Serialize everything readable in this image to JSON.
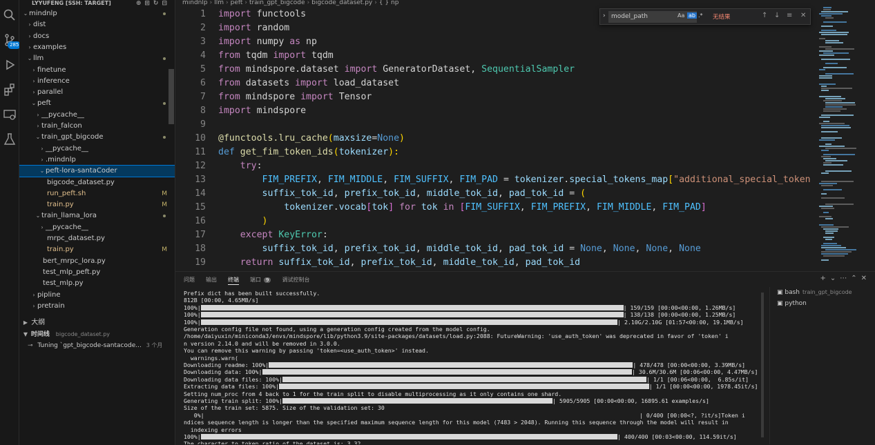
{
  "activity_bar": {
    "icons": [
      "search-icon",
      "source-control-icon",
      "run-debug-icon",
      "extensions-icon",
      "remote-explorer-icon",
      "testing-icon"
    ],
    "source_control_badge": "285"
  },
  "sidebar": {
    "header": "LYYUFENG [SSH: TARGET]",
    "tree": [
      {
        "label": "mindnlp",
        "depth": 1,
        "chev": "open",
        "dot": true
      },
      {
        "label": "dist",
        "depth": 2,
        "chev": "closed"
      },
      {
        "label": "docs",
        "depth": 2,
        "chev": "closed"
      },
      {
        "label": "examples",
        "depth": 2,
        "chev": "closed"
      },
      {
        "label": "llm",
        "depth": 2,
        "chev": "open",
        "dot": true
      },
      {
        "label": "finetune",
        "depth": 3,
        "chev": "closed"
      },
      {
        "label": "inference",
        "depth": 3,
        "chev": "closed"
      },
      {
        "label": "parallel",
        "depth": 3,
        "chev": "closed"
      },
      {
        "label": "peft",
        "depth": 3,
        "chev": "open",
        "dot": true
      },
      {
        "label": "__pycache__",
        "depth": 4,
        "chev": "closed"
      },
      {
        "label": "train_falcon",
        "depth": 4,
        "chev": "closed"
      },
      {
        "label": "train_gpt_bigcode",
        "depth": 4,
        "chev": "open",
        "dot": true
      },
      {
        "label": "__pycache__",
        "depth": 5,
        "chev": "closed"
      },
      {
        "label": ".mindnlp",
        "depth": 5,
        "chev": "closed"
      },
      {
        "label": "peft-lora-santaCoder",
        "depth": 5,
        "chev": "open",
        "selected": true
      },
      {
        "label": "bigcode_dataset.py",
        "depth": 5,
        "chev": "none",
        "active": true
      },
      {
        "label": "run_peft.sh",
        "depth": 5,
        "chev": "none",
        "git": "M",
        "modified": true
      },
      {
        "label": "train.py",
        "depth": 5,
        "chev": "none",
        "git": "M",
        "modified": true
      },
      {
        "label": "train_llama_lora",
        "depth": 4,
        "chev": "open",
        "dot": true
      },
      {
        "label": "__pycache__",
        "depth": 5,
        "chev": "closed"
      },
      {
        "label": "mrpc_dataset.py",
        "depth": 5,
        "chev": "none"
      },
      {
        "label": "train.py",
        "depth": 5,
        "chev": "none",
        "git": "M",
        "modified": true
      },
      {
        "label": "bert_mrpc_lora.py",
        "depth": 4,
        "chev": "none"
      },
      {
        "label": "test_mlp_peft.py",
        "depth": 4,
        "chev": "none"
      },
      {
        "label": "test_mlp.py",
        "depth": 4,
        "chev": "none"
      },
      {
        "label": "pipline",
        "depth": 3,
        "chev": "closed"
      },
      {
        "label": "pretrain",
        "depth": 3,
        "chev": "closed"
      }
    ],
    "outline_label": "大纲",
    "timeline_label": "时间线",
    "timeline_file": "bigcode_dataset.py",
    "timeline_entry": "Tuning `gpt_bigcode-santacode...",
    "timeline_time": "3 个月"
  },
  "editor": {
    "breadcrumb": [
      "mindnlp",
      "llm",
      "peft",
      "train_gpt_bigcode",
      "bigcode_dataset.py",
      "{ } np"
    ],
    "find": {
      "value": "model_path",
      "opt_case": "Aa",
      "opt_word": "ab",
      "opt_regex": ".*",
      "result": "无结果"
    },
    "lines": [
      {
        "n": "1"
      },
      {
        "n": "2"
      },
      {
        "n": "3"
      },
      {
        "n": "4"
      },
      {
        "n": "5"
      },
      {
        "n": "6"
      },
      {
        "n": "7"
      },
      {
        "n": "8"
      },
      {
        "n": "9"
      },
      {
        "n": "10"
      },
      {
        "n": "11"
      },
      {
        "n": "12"
      },
      {
        "n": "13"
      },
      {
        "n": "14"
      },
      {
        "n": "15"
      },
      {
        "n": "16"
      },
      {
        "n": "17"
      },
      {
        "n": "18"
      },
      {
        "n": "19"
      }
    ],
    "code": {
      "l1": [
        "import",
        " functools"
      ],
      "l2": [
        "import",
        " random"
      ],
      "l3": [
        "import",
        " numpy ",
        "as",
        " np"
      ],
      "l4": [
        "from",
        " tqdm ",
        "import",
        " tqdm"
      ],
      "l5": [
        "from",
        " mindspore.dataset ",
        "import",
        " GeneratorDataset",
        ", ",
        "SequentialSampler"
      ],
      "l6": [
        "from",
        " datasets ",
        "import",
        " load_dataset"
      ],
      "l7": [
        "from",
        " mindspore ",
        "import",
        " Tensor"
      ],
      "l8": [
        "import",
        " mindspore"
      ],
      "l10": [
        "@functools.lru_cache",
        "(",
        "maxsize",
        "=",
        "None",
        ")"
      ],
      "l11": [
        "def",
        " get_fim_token_ids",
        "(",
        "tokenizer",
        "):"
      ],
      "l12": [
        "try",
        ":"
      ],
      "l13": [
        "FIM_PREFIX",
        ", ",
        "FIM_MIDDLE",
        ", ",
        "FIM_SUFFIX",
        ", ",
        "FIM_PAD",
        " = ",
        "tokenizer",
        ".",
        "special_tokens_map",
        "[",
        "\"additional_special_token"
      ],
      "l14": [
        "suffix_tok_id",
        ", ",
        "prefix_tok_id",
        ", ",
        "middle_tok_id",
        ", ",
        "pad_tok_id",
        " = ",
        "("
      ],
      "l15": [
        "tokenizer",
        ".",
        "vocab",
        "[",
        "tok",
        "] ",
        "for",
        " tok ",
        "in",
        " [",
        "FIM_SUFFIX",
        ", ",
        "FIM_PREFIX",
        ", ",
        "FIM_MIDDLE",
        ", ",
        "FIM_PAD",
        "]"
      ],
      "l16": [
        ")"
      ],
      "l17": [
        "except",
        " KeyError",
        ":"
      ],
      "l18": [
        "suffix_tok_id",
        ", ",
        "prefix_tok_id",
        ", ",
        "middle_tok_id",
        ", ",
        "pad_tok_id",
        " = ",
        "None",
        ", ",
        "None",
        ", ",
        "None",
        ", ",
        "None"
      ],
      "l19": [
        "return",
        " suffix_tok_id",
        ", ",
        "prefix_tok_id",
        ", ",
        "middle_tok_id",
        ", ",
        "pad_tok_id"
      ]
    }
  },
  "panel": {
    "tabs": [
      "问题",
      "输出",
      "终端",
      "端口",
      "调试控制台"
    ],
    "active_tab": "终端",
    "ports_count": "9",
    "terminals": [
      {
        "name": "bash",
        "sub": "train_gpt_bigcode"
      },
      {
        "name": "python",
        "sub": ""
      }
    ],
    "terminal_lines": [
      {
        "text": "Prefix dict has been built successfully."
      },
      {
        "text": "812B [00:00, 4.65MB/s]"
      },
      {
        "text": "100%|",
        "bar": 0.72,
        "right": "| 159/159 [00:00<00:00, 1.26MB/s]"
      },
      {
        "text": "100%|",
        "bar": 0.72,
        "right": "| 138/138 [00:00<00:00, 1.25MB/s]"
      },
      {
        "text": "100%|",
        "bar": 0.71,
        "right": "| 2.10G/2.10G [01:57<00:00, 19.1MB/s]"
      },
      {
        "text": "Generation config file not found, using a generation config created from the model config."
      },
      {
        "text": "/home/daiyuxin/miniconda3/envs/mindspore/lib/python3.9/site-packages/datasets/load.py:2088: FutureWarning: 'use_auth_token' was deprecated in favor of 'token' i"
      },
      {
        "text": "n version 2.14.0 and will be removed in 3.0.0."
      },
      {
        "text": "You can remove this warning by passing 'token=<use_auth_token>' instead."
      },
      {
        "text": "  warnings.warn("
      },
      {
        "text": "Downloading readme: 100%|",
        "bar": 0.62,
        "right": "| 478/478 [00:00<00:00, 3.39MB/s]"
      },
      {
        "text": "Downloading data: 100%|",
        "bar": 0.63,
        "right": "| 30.6M/30.6M [00:06<00:00, 4.47MB/s]"
      },
      {
        "text": "Downloading data files: 100%|",
        "bar": 0.62,
        "right": "| 1/1 [00:06<00:00,  6.85s/it]"
      },
      {
        "text": "Extracting data files: 100%|",
        "bar": 0.63,
        "right": "| 1/1 [00:00<00:00, 1978.45it/s]"
      },
      {
        "text": "Setting num_proc from 4 back to 1 for the train split to disable multiprocessing as it only contains one shard."
      },
      {
        "text": "Generating train split: 100%|",
        "bar": 0.46,
        "right": "| 5905/5905 [00:00<00:00, 16895.61 examples/s]"
      },
      {
        "text": "Size of the train set: 5875. Size of the validation set: 30"
      },
      {
        "text": "   0%|",
        "bar": 0.0,
        "right": "| 0/400 [00:00<?, ?it/s]Token i"
      },
      {
        "text": "ndices sequence length is longer than the specified maximum sequence length for this model (7483 > 2048). Running this sequence through the model will result in"
      },
      {
        "text": "  indexing errors"
      },
      {
        "text": "100%|",
        "bar": 0.71,
        "right": "| 400/400 [00:03<00:00, 114.59it/s]"
      },
      {
        "text": "The character to token ratio of the dataset is: 3.32"
      }
    ]
  }
}
